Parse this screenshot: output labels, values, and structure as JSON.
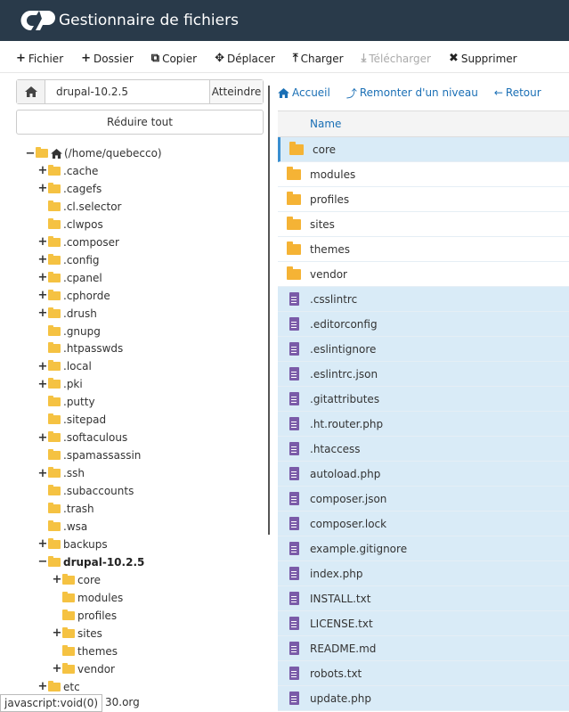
{
  "app": {
    "title": "Gestionnaire de fichiers"
  },
  "toolbar": {
    "file": "Fichier",
    "folder": "Dossier",
    "copy": "Copier",
    "move": "Déplacer",
    "upload": "Charger",
    "download": "Télécharger",
    "delete": "Supprimer"
  },
  "pathbar": {
    "value": "drupal-10.2.5",
    "go": "Atteindre",
    "collapse": "Réduire tout"
  },
  "tree": [
    {
      "label": "(/home/quebecco)",
      "toggle": "−",
      "depth": 0,
      "home": true
    },
    {
      "label": ".cache",
      "toggle": "+",
      "depth": 1
    },
    {
      "label": ".cagefs",
      "toggle": "+",
      "depth": 1
    },
    {
      "label": ".cl.selector",
      "toggle": "",
      "depth": 1
    },
    {
      "label": ".clwpos",
      "toggle": "",
      "depth": 1
    },
    {
      "label": ".composer",
      "toggle": "+",
      "depth": 1
    },
    {
      "label": ".config",
      "toggle": "+",
      "depth": 1
    },
    {
      "label": ".cpanel",
      "toggle": "+",
      "depth": 1
    },
    {
      "label": ".cphorde",
      "toggle": "+",
      "depth": 1
    },
    {
      "label": ".drush",
      "toggle": "+",
      "depth": 1
    },
    {
      "label": ".gnupg",
      "toggle": "",
      "depth": 1
    },
    {
      "label": ".htpasswds",
      "toggle": "",
      "depth": 1
    },
    {
      "label": ".local",
      "toggle": "+",
      "depth": 1
    },
    {
      "label": ".pki",
      "toggle": "+",
      "depth": 1
    },
    {
      "label": ".putty",
      "toggle": "",
      "depth": 1
    },
    {
      "label": ".sitepad",
      "toggle": "",
      "depth": 1
    },
    {
      "label": ".softaculous",
      "toggle": "+",
      "depth": 1
    },
    {
      "label": ".spamassassin",
      "toggle": "",
      "depth": 1
    },
    {
      "label": ".ssh",
      "toggle": "+",
      "depth": 1
    },
    {
      "label": ".subaccounts",
      "toggle": "",
      "depth": 1
    },
    {
      "label": ".trash",
      "toggle": "",
      "depth": 1
    },
    {
      "label": ".wsa",
      "toggle": "",
      "depth": 1
    },
    {
      "label": "backups",
      "toggle": "+",
      "depth": 1
    },
    {
      "label": "drupal-10.2.5",
      "toggle": "−",
      "depth": 1,
      "bold": true
    },
    {
      "label": "core",
      "toggle": "+",
      "depth": 2
    },
    {
      "label": "modules",
      "toggle": "",
      "depth": 2
    },
    {
      "label": "profiles",
      "toggle": "",
      "depth": 2
    },
    {
      "label": "sites",
      "toggle": "+",
      "depth": 2
    },
    {
      "label": "themes",
      "toggle": "",
      "depth": 2
    },
    {
      "label": "vendor",
      "toggle": "+",
      "depth": 2
    },
    {
      "label": "etc",
      "toggle": "+",
      "depth": 1
    }
  ],
  "nav": {
    "home": "Accueil",
    "up": "Remonter d'un niveau",
    "back": "Retour"
  },
  "list": {
    "header": "Name",
    "files": [
      {
        "name": "core",
        "type": "folder",
        "selected": true
      },
      {
        "name": "modules",
        "type": "folder",
        "selected": false
      },
      {
        "name": "profiles",
        "type": "folder",
        "selected": false
      },
      {
        "name": "sites",
        "type": "folder",
        "selected": false
      },
      {
        "name": "themes",
        "type": "folder",
        "selected": false
      },
      {
        "name": "vendor",
        "type": "folder",
        "selected": false
      },
      {
        "name": ".csslintrc",
        "type": "file",
        "selected": true
      },
      {
        "name": ".editorconfig",
        "type": "file",
        "selected": true
      },
      {
        "name": ".eslintignore",
        "type": "file",
        "selected": true
      },
      {
        "name": ".eslintrc.json",
        "type": "file",
        "selected": true
      },
      {
        "name": ".gitattributes",
        "type": "file",
        "selected": true
      },
      {
        "name": ".ht.router.php",
        "type": "file",
        "selected": true
      },
      {
        "name": ".htaccess",
        "type": "file",
        "selected": true
      },
      {
        "name": "autoload.php",
        "type": "file",
        "selected": true
      },
      {
        "name": "composer.json",
        "type": "file",
        "selected": true
      },
      {
        "name": "composer.lock",
        "type": "file",
        "selected": true
      },
      {
        "name": "example.gitignore",
        "type": "file",
        "selected": true
      },
      {
        "name": "index.php",
        "type": "file",
        "selected": true
      },
      {
        "name": "INSTALL.txt",
        "type": "file",
        "selected": true
      },
      {
        "name": "LICENSE.txt",
        "type": "file",
        "selected": true
      },
      {
        "name": "README.md",
        "type": "file",
        "selected": true
      },
      {
        "name": "robots.txt",
        "type": "file",
        "selected": true
      },
      {
        "name": "update.php",
        "type": "file",
        "selected": true
      }
    ]
  },
  "status": {
    "text": "javascript:void(0)",
    "tail": "30.org"
  },
  "colors": {
    "header_bg": "#293a4a",
    "folder": "#f5b335",
    "file": "#7a5ba8",
    "selection": "#d9ebf7",
    "link": "#1a6fb5"
  }
}
